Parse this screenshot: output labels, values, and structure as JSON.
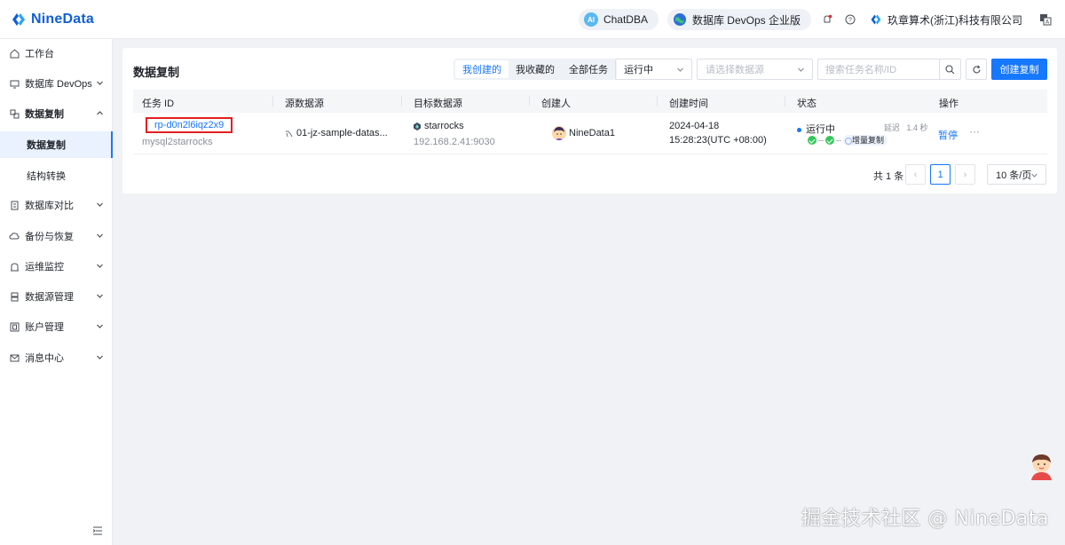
{
  "brand": {
    "name": "NineData"
  },
  "header": {
    "chatdba_label": "ChatDBA",
    "edition_label": "数据库 DevOps 企业版",
    "company_name": "玖章算术(浙江)科技有限公司"
  },
  "sidebar": {
    "items": [
      {
        "label": "工作台"
      },
      {
        "label": "数据库 DevOps"
      },
      {
        "label": "数据复制"
      },
      {
        "label": "数据复制"
      },
      {
        "label": "结构转换"
      },
      {
        "label": "数据库对比"
      },
      {
        "label": "备份与恢复"
      },
      {
        "label": "运维监控"
      },
      {
        "label": "数据源管理"
      },
      {
        "label": "账户管理"
      },
      {
        "label": "消息中心"
      }
    ]
  },
  "page": {
    "title": "数据复制",
    "filter_tabs": [
      "我创建的",
      "我收藏的",
      "全部任务"
    ],
    "active_tab": "我创建的",
    "status_filter": "运行中",
    "datasource_placeholder": "请选择数据源",
    "search_placeholder": "搜索任务名称/ID",
    "create_button": "创建复制"
  },
  "table": {
    "columns": [
      "任务 ID",
      "源数据源",
      "目标数据源",
      "创建人",
      "创建时间",
      "状态",
      "操作"
    ],
    "rows": [
      {
        "task_id": "rp-d0n2l6iqz2x9",
        "task_name": "mysql2starrocks",
        "source": "01-jz-sample-datas...",
        "target_name": "starrocks",
        "target_addr": "192.168.2.41:9030",
        "creator": "NineData1",
        "created_date": "2024-04-18",
        "created_time": "15:28:23(UTC +08:00)",
        "status": "运行中",
        "delay_label": "延迟",
        "delay_value": "1.4 秒",
        "phase": "增量复制",
        "action_pause": "暂停",
        "action_more": "···"
      }
    ]
  },
  "pagination": {
    "total": "共 1 条",
    "current_page": "1",
    "page_size": "10 条/页"
  },
  "watermark": "掘金技术社区 @ NineData",
  "colors": {
    "primary": "#1677ff",
    "brand": "#0f5fd6",
    "success": "#34c759",
    "highlight_border": "#e02020"
  }
}
